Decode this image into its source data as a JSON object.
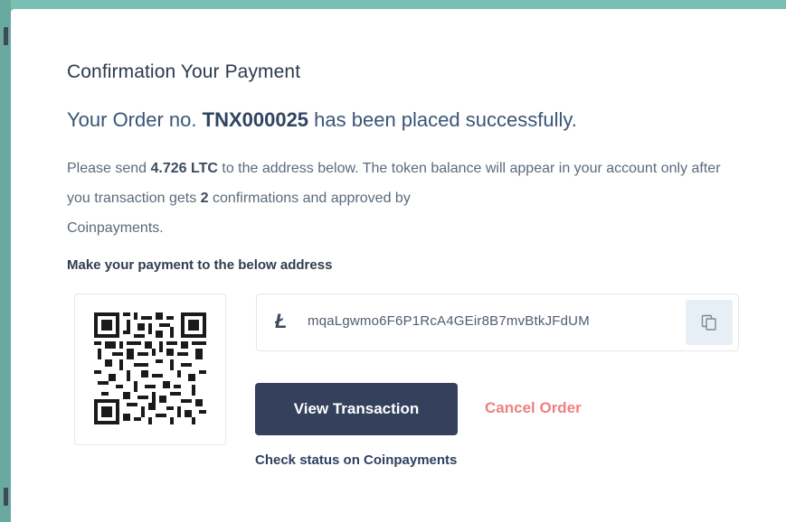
{
  "modal": {
    "title": "Confirmation Your Payment",
    "order_prefix": "Your Order no.",
    "order_number": "TNX000025",
    "order_suffix": "has been placed successfully.",
    "desc_part1": "Please send",
    "amount": "4.726 LTC",
    "desc_part2": "to the address below. The token balance will appear in your account only after you transaction gets",
    "confirmations": "2",
    "desc_part3": "confirmations and approved by",
    "provider": "Coinpayments",
    "desc_end": "."
  },
  "payment": {
    "address_label": "Make your payment to the below address",
    "currency_icon": "litecoin-icon",
    "currency_glyph": "Ł",
    "address": "mqaLgwmo6F6P1RcA4GEir8B7mvBtkJFdUM",
    "copy_icon": "copy-icon",
    "qr_icon": "qr-code"
  },
  "actions": {
    "view_transaction": "View Transaction",
    "cancel_order": "Cancel Order",
    "check_status": "Check status on Coinpayments"
  },
  "colors": {
    "background": "#7bbfb4",
    "primary_button": "#34405c",
    "cancel": "#f07f80",
    "copy_button_bg": "#e8eef6"
  }
}
